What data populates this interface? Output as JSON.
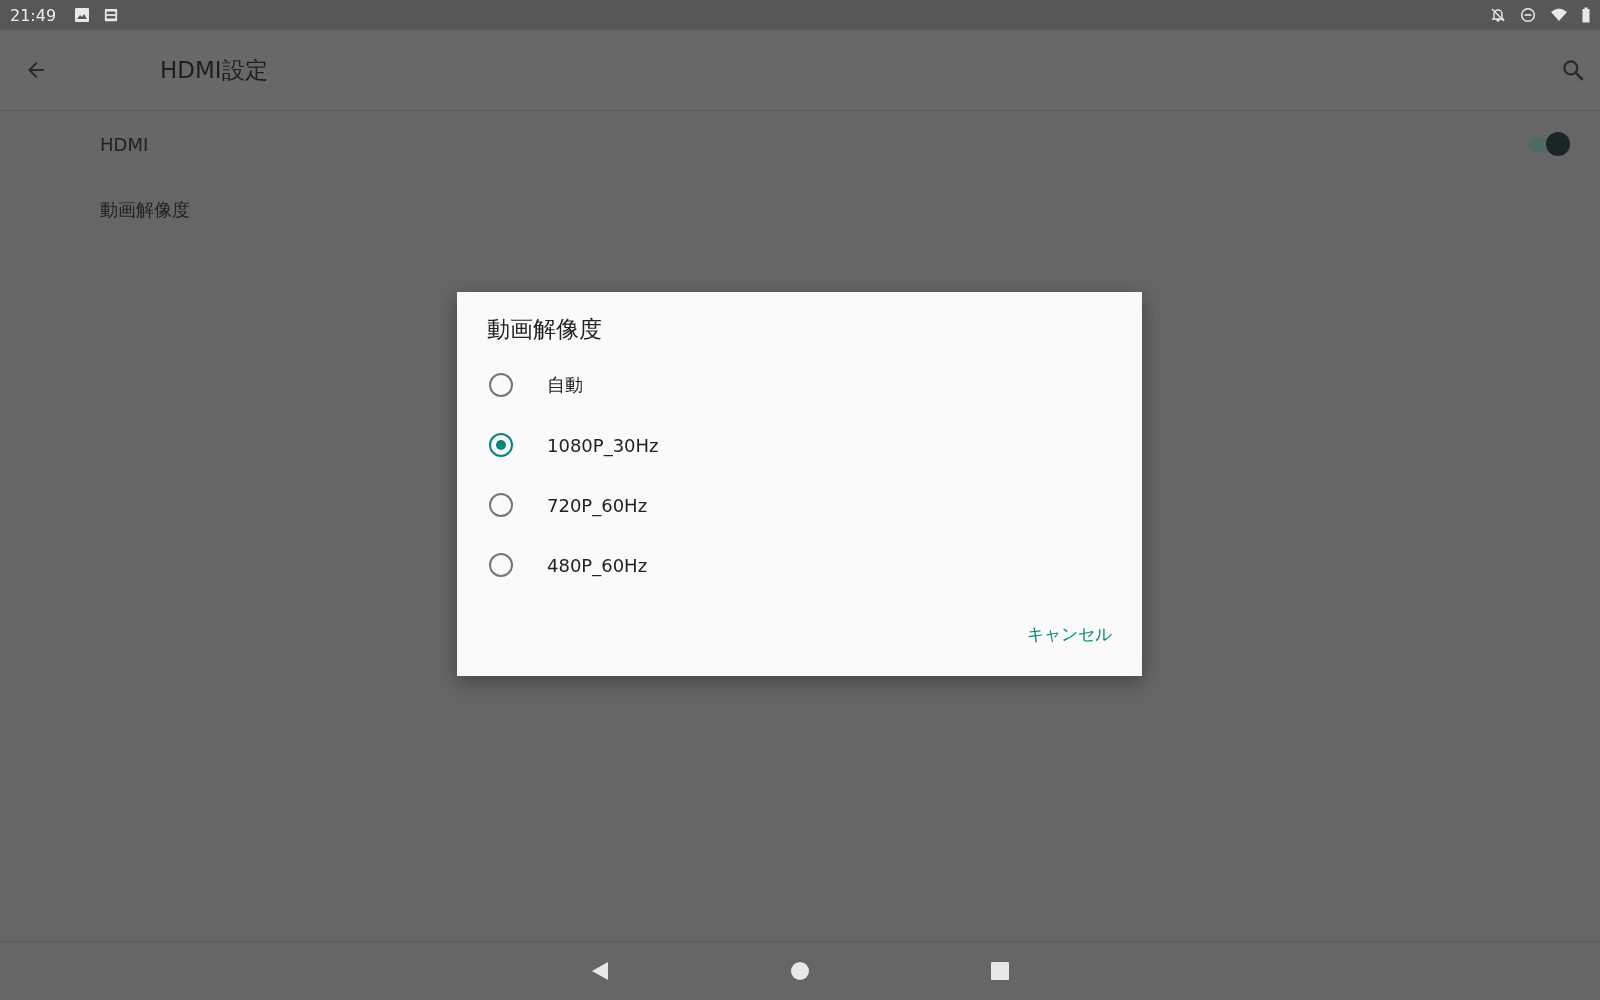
{
  "status_bar": {
    "time": "21:49"
  },
  "toolbar": {
    "title": "HDMI設定"
  },
  "settings": [
    {
      "kind": "switch",
      "label": "HDMI",
      "on": true
    },
    {
      "kind": "plain",
      "label": "動画解像度"
    }
  ],
  "dialog": {
    "title": "動画解像度",
    "options": [
      {
        "label": "自動",
        "selected": false
      },
      {
        "label": "1080P_30Hz",
        "selected": true
      },
      {
        "label": "720P_60Hz",
        "selected": false
      },
      {
        "label": "480P_60Hz",
        "selected": false
      }
    ],
    "buttons": [
      "キャンセル"
    ]
  }
}
